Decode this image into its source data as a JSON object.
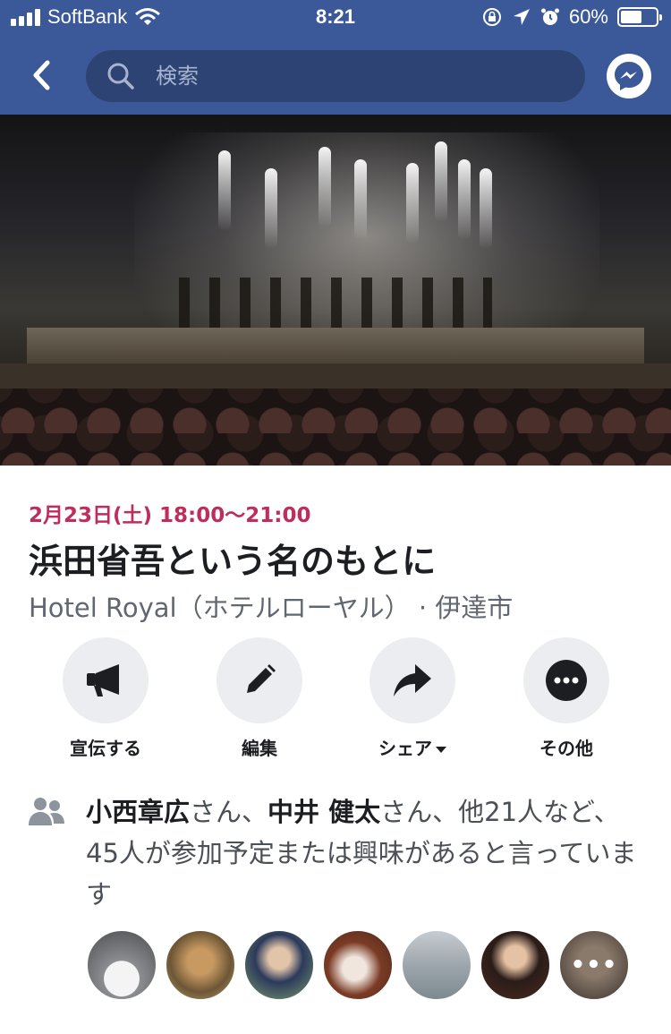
{
  "status_bar": {
    "carrier": "SoftBank",
    "time": "8:21",
    "battery_percent": "60%",
    "battery_level": 0.6
  },
  "nav": {
    "search_placeholder": "検索",
    "icons": {
      "back": "chevron-left-icon",
      "search": "search-icon",
      "messenger": "messenger-icon"
    }
  },
  "event": {
    "date_time": "2月23日(土) 18:00〜21:00",
    "title": "浜田省吾という名のもとに",
    "location": "Hotel Royal（ホテルローヤル） · 伊達市"
  },
  "actions": [
    {
      "label": "宣伝する",
      "icon": "megaphone-icon"
    },
    {
      "label": "編集",
      "icon": "pencil-icon"
    },
    {
      "label": "シェア",
      "icon": "share-arrow-icon"
    },
    {
      "label": "その他",
      "icon": "more-dots-icon"
    }
  ],
  "attendees": {
    "name1": "小西章広",
    "suffix1": "さん、",
    "name2": "中井 健太",
    "rest": "さん、他21人など、45人が参加予定または興味があると言っています"
  },
  "avatars": [
    "avatar-1",
    "avatar-2",
    "avatar-3",
    "avatar-4",
    "avatar-5",
    "avatar-6",
    "avatar-7"
  ],
  "colors": {
    "brand": "#3b5998",
    "date": "#be2e5c",
    "action_bg": "#ebedf0"
  }
}
